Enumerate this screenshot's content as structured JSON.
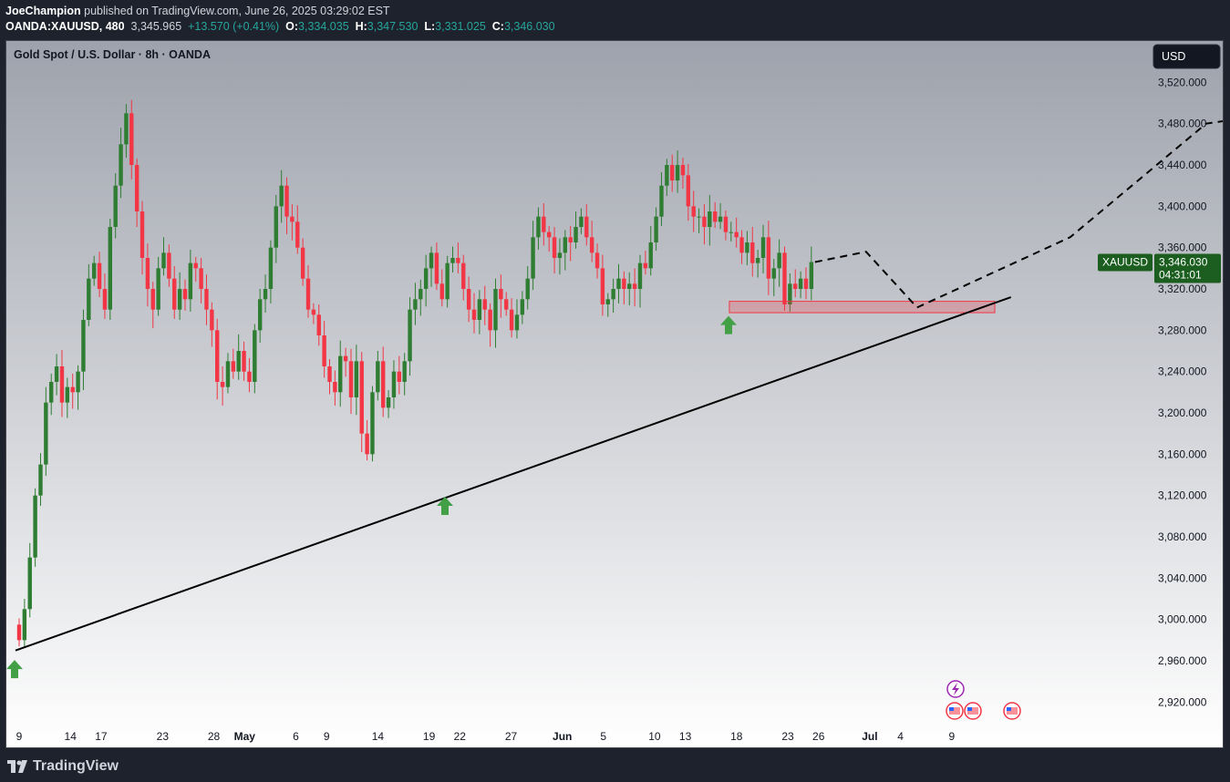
{
  "header": {
    "author": "JoeChampion",
    "published": "published on TradingView.com, June 26, 2025 03:29:02 EST",
    "symbol": "OANDA:XAUUSD, 480",
    "last": "3,345.965",
    "change": "+13.570 (+0.41%)",
    "o_label": "O:",
    "o_value": "3,334.035",
    "h_label": "H:",
    "h_value": "3,347.530",
    "l_label": "L:",
    "l_value": "3,331.025",
    "c_label": "C:",
    "c_value": "3,346.030"
  },
  "footer": {
    "brand": "TradingView"
  },
  "colors": {
    "up": "#2e7d32",
    "down": "#f23645",
    "support": "#f23645",
    "arrow": "#43a047",
    "bg_top": "#9ea2ac",
    "bg_bottom": "#ffffff"
  },
  "chart_data": {
    "type": "candlestick",
    "title": "Gold Spot / U.S. Dollar · 8h · OANDA",
    "currency": "USD",
    "ylim": [
      2900,
      3560
    ],
    "y_ticks": [
      2920,
      2960,
      3000,
      3040,
      3080,
      3120,
      3160,
      3200,
      3240,
      3280,
      3320,
      3360,
      3400,
      3440,
      3480,
      3520
    ],
    "y_tick_labels": [
      "2,920.000",
      "2,960.000",
      "3,000.000",
      "3,040.000",
      "3,080.000",
      "3,120.000",
      "3,160.000",
      "3,200.000",
      "3,240.000",
      "3,280.000",
      "3,320.000",
      "3,360.000",
      "3,400.000",
      "3,440.000",
      "3,480.000",
      "3,520.000"
    ],
    "x_ticks": [
      {
        "label": "9",
        "day": 0
      },
      {
        "label": "14",
        "day": 5
      },
      {
        "label": "17",
        "day": 8
      },
      {
        "label": "23",
        "day": 14
      },
      {
        "label": "28",
        "day": 19
      },
      {
        "label": "May",
        "day": 22,
        "bold": true
      },
      {
        "label": "6",
        "day": 27
      },
      {
        "label": "9",
        "day": 30
      },
      {
        "label": "14",
        "day": 35
      },
      {
        "label": "19",
        "day": 40
      },
      {
        "label": "22",
        "day": 43
      },
      {
        "label": "27",
        "day": 48
      },
      {
        "label": "Jun",
        "day": 53,
        "bold": true
      },
      {
        "label": "5",
        "day": 57
      },
      {
        "label": "10",
        "day": 62
      },
      {
        "label": "13",
        "day": 65
      },
      {
        "label": "18",
        "day": 70
      },
      {
        "label": "23",
        "day": 75
      },
      {
        "label": "26",
        "day": 78
      },
      {
        "label": "Jul",
        "day": 83,
        "bold": true
      },
      {
        "label": "4",
        "day": 86
      },
      {
        "label": "9",
        "day": 91
      }
    ],
    "price_tag": {
      "symbol": "XAUUSD",
      "price": "3,346.030",
      "countdown": "04:31:01",
      "value": 3346.03
    },
    "closes": [
      2980,
      3010,
      3060,
      3120,
      3150,
      3210,
      3230,
      3245,
      3210,
      3225,
      3220,
      3240,
      3290,
      3330,
      3345,
      3320,
      3300,
      3380,
      3420,
      3460,
      3490,
      3440,
      3395,
      3350,
      3320,
      3300,
      3340,
      3355,
      3330,
      3300,
      3320,
      3310,
      3345,
      3340,
      3320,
      3300,
      3280,
      3230,
      3225,
      3250,
      3240,
      3260,
      3240,
      3230,
      3280,
      3310,
      3320,
      3360,
      3400,
      3420,
      3390,
      3385,
      3360,
      3330,
      3300,
      3295,
      3275,
      3245,
      3230,
      3220,
      3255,
      3250,
      3215,
      3250,
      3180,
      3160,
      3220,
      3250,
      3205,
      3215,
      3240,
      3230,
      3250,
      3300,
      3310,
      3320,
      3340,
      3355,
      3325,
      3310,
      3345,
      3350,
      3345,
      3320,
      3300,
      3290,
      3310,
      3300,
      3280,
      3320,
      3310,
      3300,
      3280,
      3295,
      3310,
      3330,
      3370,
      3390,
      3375,
      3370,
      3350,
      3355,
      3370,
      3365,
      3380,
      3390,
      3370,
      3355,
      3340,
      3305,
      3310,
      3320,
      3330,
      3320,
      3325,
      3320,
      3345,
      3340,
      3365,
      3390,
      3420,
      3440,
      3425,
      3440,
      3430,
      3400,
      3390,
      3390,
      3380,
      3395,
      3385,
      3390,
      3375,
      3375,
      3370,
      3355,
      3365,
      3345,
      3350,
      3370,
      3330,
      3340,
      3355,
      3305,
      3325,
      3320,
      3330,
      3320,
      3346
    ],
    "support_zone": {
      "from": 3297,
      "to": 3308
    },
    "trendline": {
      "points": [
        {
          "day": 0,
          "value": 2970
        },
        {
          "day": 88.5,
          "value": 3312
        }
      ]
    },
    "projection": {
      "points": [
        {
          "day": 76.2,
          "value": 3346
        },
        {
          "day": 76.8,
          "value": 3356
        },
        {
          "day": 77.4,
          "value": 3302
        },
        {
          "day": 79.2,
          "value": 3370
        },
        {
          "day": 80.8,
          "value": 3480
        },
        {
          "day": 81.3,
          "value": 3486
        },
        {
          "day": 81.7,
          "value": 3475
        }
      ]
    },
    "up_arrows": [
      {
        "day": 0.5,
        "value": 2952
      },
      {
        "day": 36.4,
        "value": 3110
      },
      {
        "day": 56.7,
        "value": 3285
      }
    ]
  }
}
